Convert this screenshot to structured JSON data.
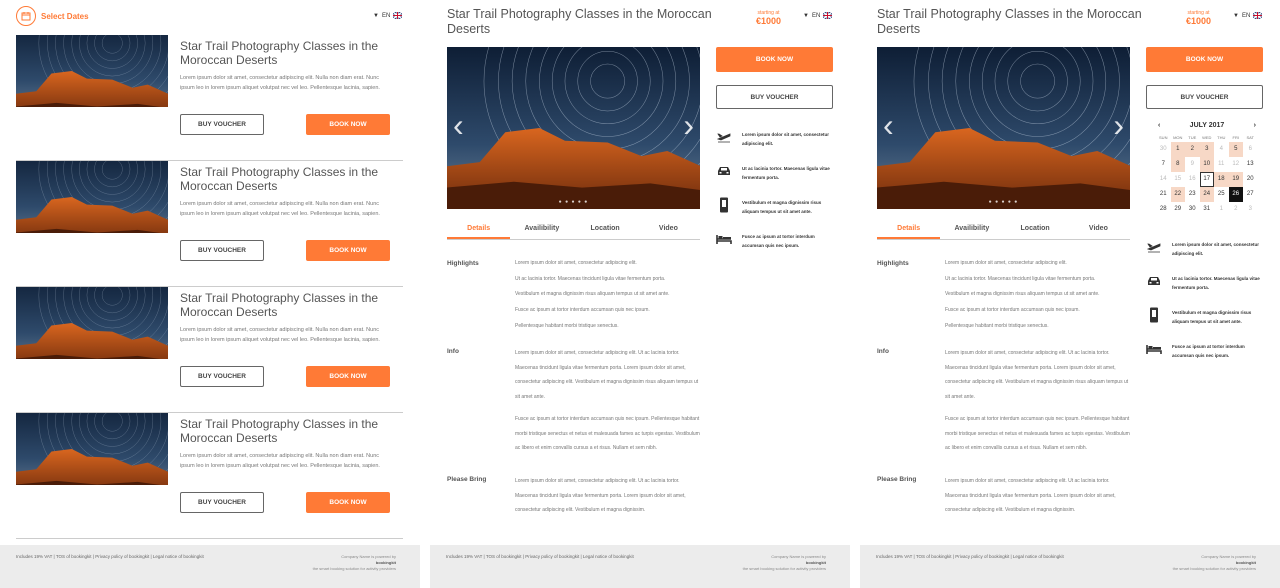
{
  "colors": {
    "accent": "#ff7a36",
    "footer_bg": "#ececec"
  },
  "list_view": {
    "select_dates": "Select Dates",
    "lang": "EN",
    "cards": [
      {
        "title": "Star Trail Photography Classes in the Moroccan Deserts",
        "desc": "Lorem ipsum dolor sit amet, consectetur adipiscing elit. Nulla non diam erat. Nunc ipsum leo in lorem ipsum aliquet volutpat nec vel leo. Pellentesque lacinia, sapien.",
        "voucher": "BUY VOUCHER",
        "book": "BOOK NOW"
      },
      {
        "title": "Star Trail Photography Classes in the Moroccan Deserts",
        "desc": "Lorem ipsum dolor sit amet, consectetur adipiscing elit. Nulla non diam erat. Nunc ipsum leo in lorem ipsum aliquet volutpat nec vel leo. Pellentesque lacinia, sapien.",
        "voucher": "BUY VOUCHER",
        "book": "BOOK NOW"
      },
      {
        "title": "Star Trail Photography Classes in the Moroccan Deserts",
        "desc": "Lorem ipsum dolor sit amet, consectetur adipiscing elit. Nulla non diam erat. Nunc ipsum leo in lorem ipsum aliquet volutpat nec vel leo. Pellentesque lacinia, sapien.",
        "voucher": "BUY VOUCHER",
        "book": "BOOK NOW"
      },
      {
        "title": "Star Trail Photography Classes in the Moroccan Deserts",
        "desc": "Lorem ipsum dolor sit amet, consectetur adipiscing elit. Nulla non diam erat. Nunc ipsum leo in lorem ipsum aliquet volutpat nec vel leo. Pellentesque lacinia, sapien.",
        "voucher": "BUY VOUCHER",
        "book": "BOOK NOW"
      }
    ]
  },
  "detail": {
    "title": "Star Trail Photography Classes in the Moroccan Deserts",
    "price_label": "starting at",
    "price": "€1000",
    "lang": "EN",
    "book": "BOOK NOW",
    "voucher": "BUY VOUCHER",
    "tabs": [
      "Details",
      "Availibility",
      "Location",
      "Video"
    ],
    "features": [
      {
        "icon": "plane-icon",
        "text": "Lorem ipsum dolor sit amet, consectetur adipiscing elit."
      },
      {
        "icon": "car-icon",
        "text": "Ut ac lacinia tortor. Maecenas ligula vitae fermentum porta."
      },
      {
        "icon": "phone-icon",
        "text": "Vestibulum et magna dignissim risus aliquam tempus ut sit amet ante."
      },
      {
        "icon": "bed-icon",
        "text": "Fusce ac ipsum at tortor interdum accumsan quis nec ipsum."
      }
    ],
    "sections": {
      "highlights": {
        "label": "Highlights",
        "lines": [
          "Lorem ipsum dolor sit amet, consectetur adipiscing elit.",
          "Ut ac lacinia tortor. Maecenas tincidunt ligula vitae fermentum porta.",
          "Vestibulum et magna dignissim risus aliquam tempus ut sit amet ante.",
          "Fusce ac ipsum at tortor interdum accumsan quis nec ipsum.",
          "Pellentesque habitant morbi tristique senectus."
        ]
      },
      "info": {
        "label": "Info",
        "p1": "Lorem ipsum dolor sit amet, consectetur adipiscing elit. Ut ac lacinia tortor. Maecenas tincidunt ligula vitae fermentum porta. Lorem ipsum dolor sit amet, consectetur adipiscing elit. Vestibulum et magna dignissim risus aliquam tempus ut sit amet ante.",
        "p2": "Fusce ac ipsum at tortor interdum accumsan quis nec ipsum. Pellentesque habitant morbi tristique senectus et netus et malesuada fames ac turpis egestas. Vestibulum ac libero et enim convallis cursus a et risus. Nullam et sem nibh."
      },
      "bring": {
        "label": "Please Bring",
        "p": "Lorem ipsum dolor sit amet, consectetur adipiscing elit. Ut ac lacinia tortor. Maecenas tincidunt ligula vitae fermentum porta. Lorem ipsum dolor sit amet, consectetur adipiscing elit. Vestibulum et magna dignissim."
      }
    },
    "calendar": {
      "month": "JULY 2017",
      "dow": [
        "SUN",
        "MON",
        "TUE",
        "WED",
        "THU",
        "FRI",
        "SAT"
      ],
      "days": [
        {
          "d": "30",
          "t": "m"
        },
        {
          "d": "1",
          "t": "av"
        },
        {
          "d": "2",
          "t": "av"
        },
        {
          "d": "3",
          "t": "av"
        },
        {
          "d": "4",
          "t": "m"
        },
        {
          "d": "5",
          "t": "av"
        },
        {
          "d": "6",
          "t": "m"
        },
        {
          "d": "7",
          "t": ""
        },
        {
          "d": "8",
          "t": "av"
        },
        {
          "d": "9",
          "t": "m"
        },
        {
          "d": "10",
          "t": "av"
        },
        {
          "d": "11",
          "t": "m"
        },
        {
          "d": "12",
          "t": "m"
        },
        {
          "d": "13",
          "t": ""
        },
        {
          "d": "14",
          "t": "m"
        },
        {
          "d": "15",
          "t": "m"
        },
        {
          "d": "16",
          "t": "m"
        },
        {
          "d": "17",
          "t": "today"
        },
        {
          "d": "18",
          "t": "av"
        },
        {
          "d": "19",
          "t": "av"
        },
        {
          "d": "20",
          "t": ""
        },
        {
          "d": "21",
          "t": ""
        },
        {
          "d": "22",
          "t": "av"
        },
        {
          "d": "23",
          "t": ""
        },
        {
          "d": "24",
          "t": "av"
        },
        {
          "d": "25",
          "t": ""
        },
        {
          "d": "26",
          "t": "sel"
        },
        {
          "d": "27",
          "t": ""
        },
        {
          "d": "28",
          "t": ""
        },
        {
          "d": "29",
          "t": ""
        },
        {
          "d": "30",
          "t": ""
        },
        {
          "d": "31",
          "t": ""
        },
        {
          "d": "1",
          "t": "m"
        },
        {
          "d": "2",
          "t": "m"
        },
        {
          "d": "3",
          "t": "m"
        }
      ]
    }
  },
  "footer": {
    "links": "Includes 19% VAT | TOS of bookingkit | Privacy policy of bookingkit | Legal notice of bookingkit",
    "powered": "Company Name is powered by",
    "brand": "bookingkit",
    "tagline": "the smart booking solution for activity providers"
  }
}
